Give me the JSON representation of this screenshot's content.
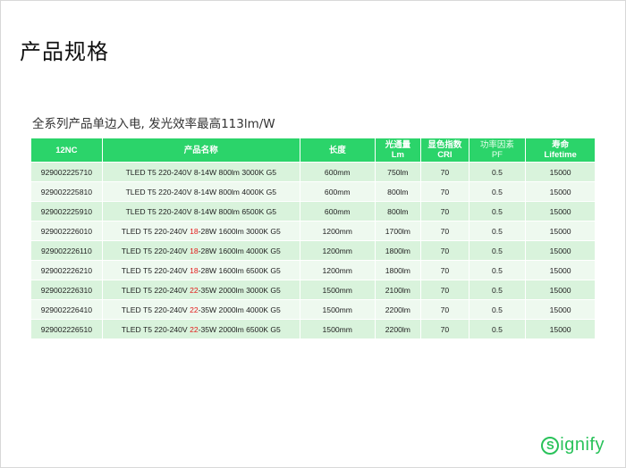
{
  "page": {
    "title": "产品规格",
    "subtitle": "全系列产品单边入电, 发光效率最高113lm/W"
  },
  "table": {
    "headers": [
      {
        "line1": "12NC",
        "line2": ""
      },
      {
        "line1": "产品名称",
        "line2": ""
      },
      {
        "line1": "长度",
        "line2": ""
      },
      {
        "line1": "光通量",
        "line2": "Lm"
      },
      {
        "line1": "显色指数",
        "line2": "CRI"
      },
      {
        "line1": "功率因素",
        "line2": "PF"
      },
      {
        "line1": "寿命",
        "line2": "Lifetime"
      }
    ],
    "rows": [
      {
        "nc": "929002225710",
        "name_pre": "TLED T5 220-240V 8-14W 800lm 3000K G5",
        "name_red": "",
        "name_post": "",
        "length": "600mm",
        "lumen": "750lm",
        "cri": "70",
        "pf": "0.5",
        "lifetime": "15000"
      },
      {
        "nc": "929002225810",
        "name_pre": "TLED T5 220-240V 8-14W 800lm 4000K G5",
        "name_red": "",
        "name_post": "",
        "length": "600mm",
        "lumen": "800lm",
        "cri": "70",
        "pf": "0.5",
        "lifetime": "15000"
      },
      {
        "nc": "929002225910",
        "name_pre": "TLED T5 220-240V 8-14W 800lm 6500K G5",
        "name_red": "",
        "name_post": "",
        "length": "600mm",
        "lumen": "800lm",
        "cri": "70",
        "pf": "0.5",
        "lifetime": "15000"
      },
      {
        "nc": "929002226010",
        "name_pre": "TLED T5 220-240V ",
        "name_red": "18",
        "name_post": "-28W 1600lm 3000K G5",
        "length": "1200mm",
        "lumen": "1700lm",
        "cri": "70",
        "pf": "0.5",
        "lifetime": "15000"
      },
      {
        "nc": "929002226110",
        "name_pre": "TLED T5 220-240V ",
        "name_red": "18",
        "name_post": "-28W 1600lm 4000K G5",
        "length": "1200mm",
        "lumen": "1800lm",
        "cri": "70",
        "pf": "0.5",
        "lifetime": "15000"
      },
      {
        "nc": "929002226210",
        "name_pre": "TLED T5 220-240V ",
        "name_red": "18",
        "name_post": "-28W 1600lm 6500K G5",
        "length": "1200mm",
        "lumen": "1800lm",
        "cri": "70",
        "pf": "0.5",
        "lifetime": "15000"
      },
      {
        "nc": "929002226310",
        "name_pre": "TLED T5 220-240V ",
        "name_red": "22",
        "name_post": "-35W 2000lm 3000K G5",
        "length": "1500mm",
        "lumen": "2100lm",
        "cri": "70",
        "pf": "0.5",
        "lifetime": "15000"
      },
      {
        "nc": "929002226410",
        "name_pre": "TLED T5 220-240V ",
        "name_red": "22",
        "name_post": "-35W 2000lm 4000K G5",
        "length": "1500mm",
        "lumen": "2200lm",
        "cri": "70",
        "pf": "0.5",
        "lifetime": "15000"
      },
      {
        "nc": "929002226510",
        "name_pre": "TLED T5 220-240V ",
        "name_red": "22",
        "name_post": "-35W 2000lm 6500K G5",
        "length": "1500mm",
        "lumen": "2200lm",
        "cri": "70",
        "pf": "0.5",
        "lifetime": "15000"
      }
    ]
  },
  "logo": {
    "mark": "S",
    "text": "ignify",
    "icon": "signify-s-icon"
  },
  "colors": {
    "header_green": "#2bd46a",
    "row_odd": "#d9f3dc",
    "row_even": "#eef9ef",
    "highlight_red": "#e31b1b",
    "brand_green": "#29c25a"
  }
}
